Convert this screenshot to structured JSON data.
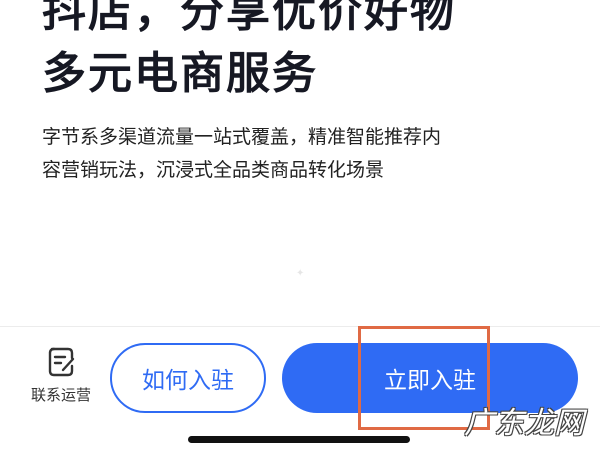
{
  "headline": {
    "line1": "抖店，分享优价好物",
    "line2": "多元电商服务"
  },
  "description": {
    "line1": "字节系多渠道流量一站式覆盖，精准智能推荐内",
    "line2": "容营销玩法，沉浸式全品类商品转化场景"
  },
  "bottom_bar": {
    "contact_icon": "edit-note-icon",
    "contact_label": "联系运营",
    "how_to_join_label": "如何入驻",
    "join_now_label": "立即入驻"
  },
  "watermark": "广东龙网",
  "colors": {
    "accent": "#2f6bf4",
    "highlight": "#e06a44",
    "text": "#161823"
  }
}
